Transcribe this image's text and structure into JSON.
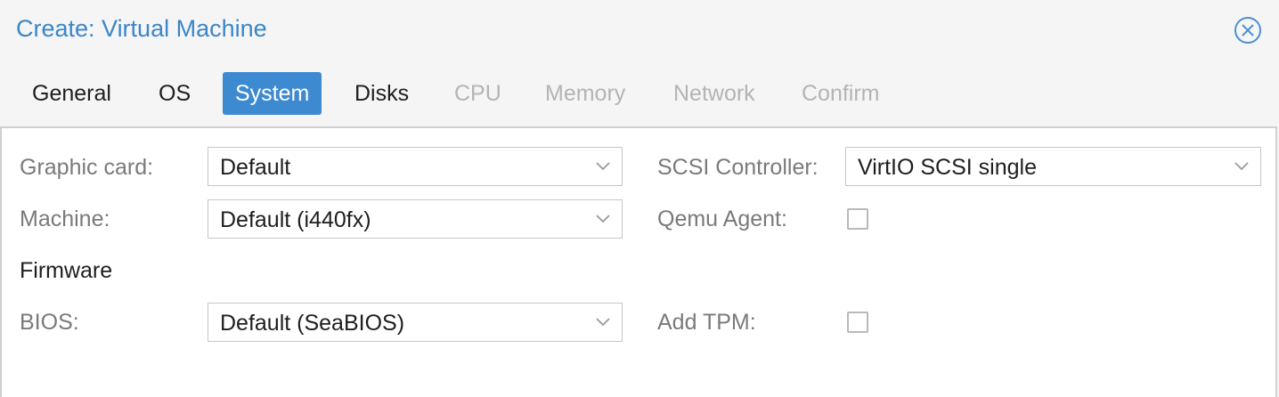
{
  "window": {
    "title": "Create: Virtual Machine"
  },
  "tabs": [
    {
      "label": "General",
      "state": "normal"
    },
    {
      "label": "OS",
      "state": "normal"
    },
    {
      "label": "System",
      "state": "active"
    },
    {
      "label": "Disks",
      "state": "normal"
    },
    {
      "label": "CPU",
      "state": "disabled"
    },
    {
      "label": "Memory",
      "state": "disabled"
    },
    {
      "label": "Network",
      "state": "disabled"
    },
    {
      "label": "Confirm",
      "state": "disabled"
    }
  ],
  "form": {
    "graphic_card": {
      "label": "Graphic card:",
      "value": "Default"
    },
    "machine": {
      "label": "Machine:",
      "value": "Default (i440fx)"
    },
    "firmware_section": "Firmware",
    "bios": {
      "label": "BIOS:",
      "value": "Default (SeaBIOS)"
    },
    "scsi_controller": {
      "label": "SCSI Controller:",
      "value": "VirtIO SCSI single"
    },
    "qemu_agent": {
      "label": "Qemu Agent:",
      "checked": false
    },
    "add_tpm": {
      "label": "Add TPM:",
      "checked": false
    }
  },
  "colors": {
    "accent": "#3d8ad1",
    "title": "#3a86c8",
    "disabled_text": "#b4b4b4",
    "label_text": "#7a7a7a"
  },
  "icons": {
    "close": "close-circle-icon",
    "dropdown": "chevron-down-icon"
  }
}
